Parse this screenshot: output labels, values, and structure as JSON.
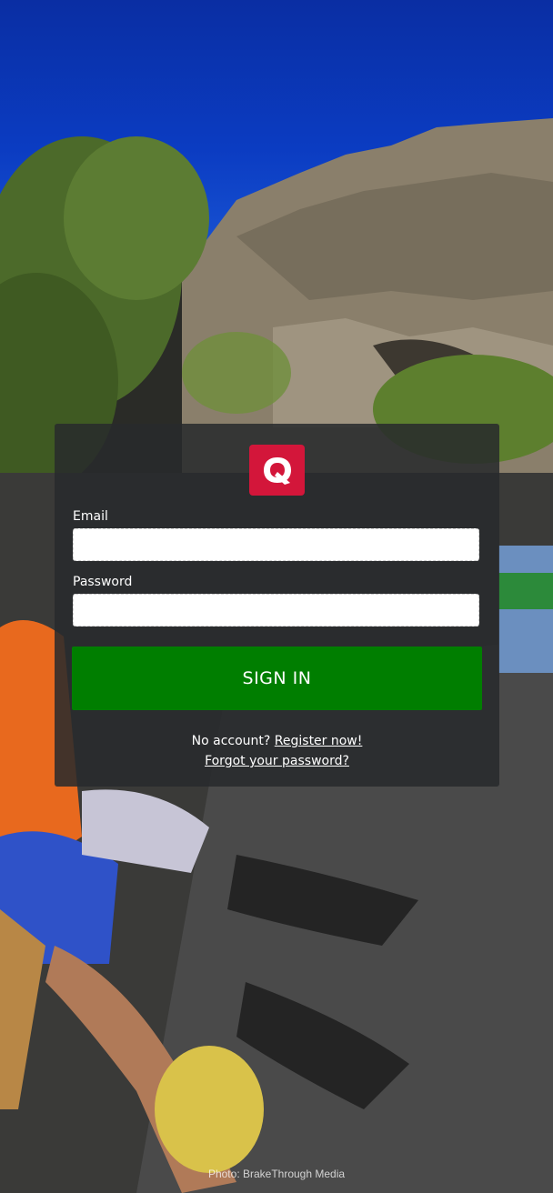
{
  "background": {
    "photo_credit": "Photo: BrakeThrough Media"
  },
  "brand": {
    "logo_icon": "q-logo-icon",
    "logo_color": "#d3163a"
  },
  "form": {
    "email_label": "Email",
    "email_value": "",
    "password_label": "Password",
    "password_value": "",
    "signin_label": "SIGN IN",
    "signin_color": "#007e00",
    "no_account_text": "No account?",
    "register_link": "Register now!",
    "forgot_link": "Forgot your password?"
  }
}
